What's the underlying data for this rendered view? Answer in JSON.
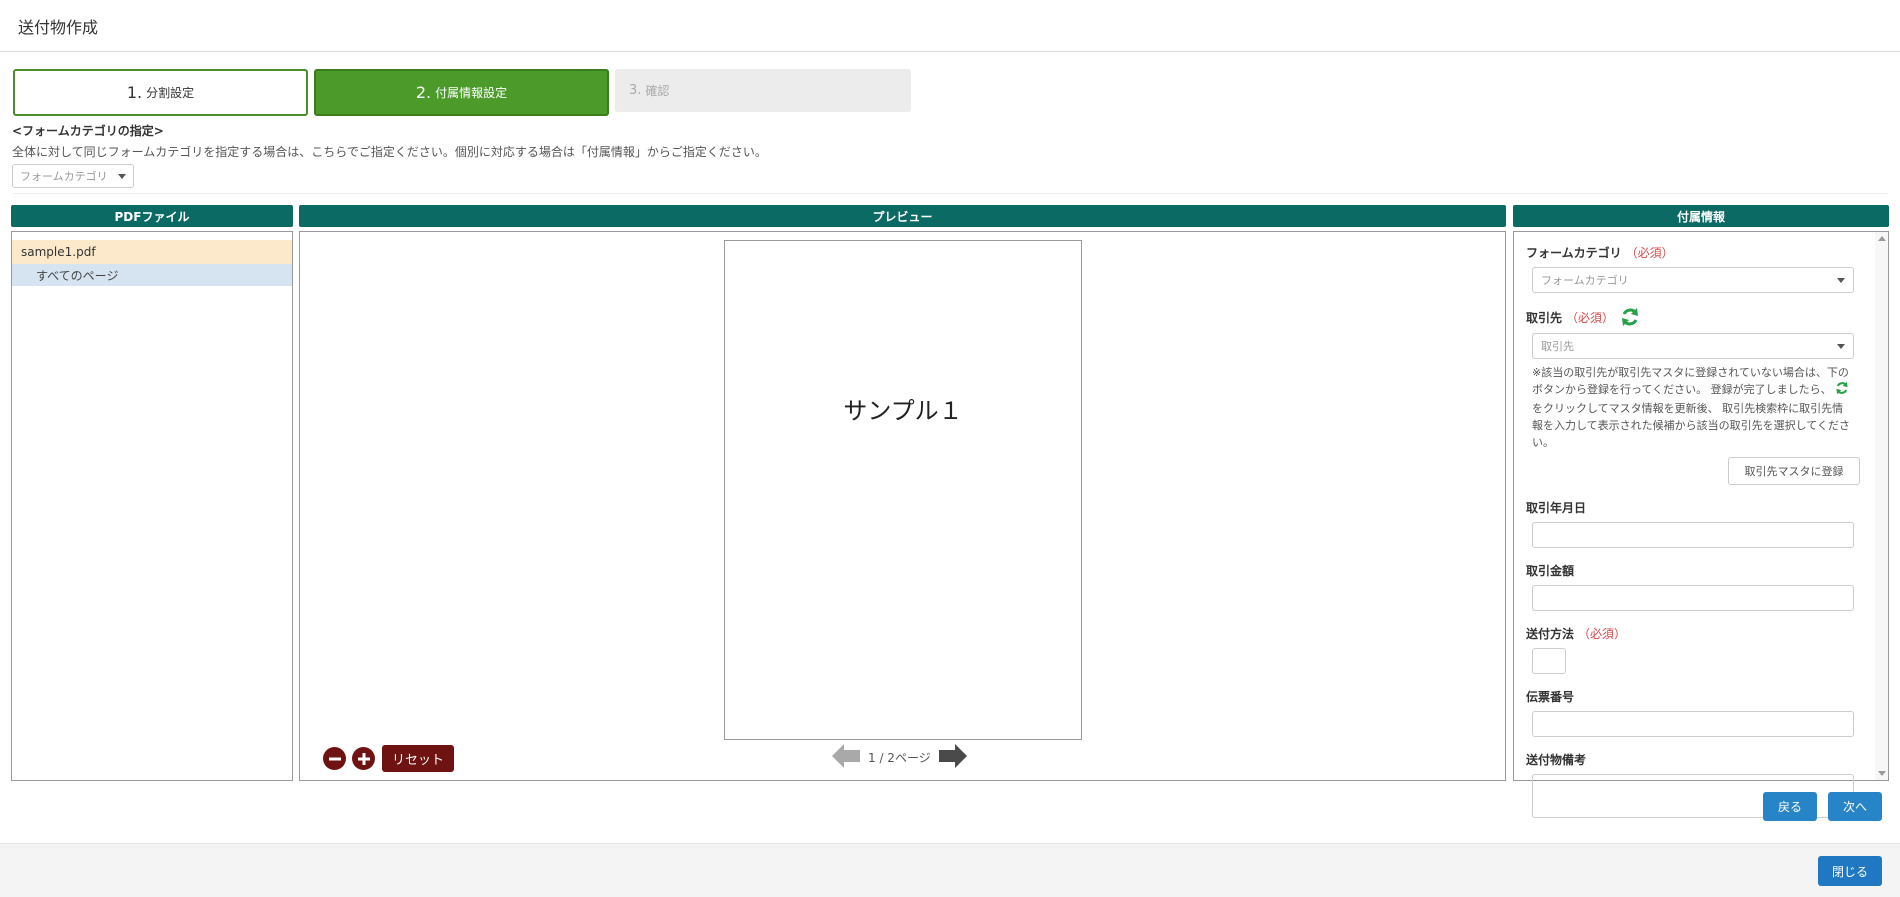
{
  "header": {
    "title": "送付物作成"
  },
  "steps": [
    {
      "num": "1.",
      "label": "分割設定"
    },
    {
      "num": "2.",
      "label": "付属情報設定"
    },
    {
      "num": "3.",
      "label": "確認"
    }
  ],
  "form_category": {
    "heading": "<フォームカテゴリの指定>",
    "description": "全体に対して同じフォームカテゴリを指定する場合は、こちらでご指定ください。個別に対応する場合は「付属情報」からご指定ください。",
    "select_placeholder": "フォームカテゴリ"
  },
  "pdf_panel": {
    "title": "PDFファイル",
    "file": "sample1.pdf",
    "pages_item": "すべてのページ"
  },
  "preview_panel": {
    "title": "プレビュー",
    "page_text": "サンプル１",
    "reset_label": "リセット",
    "page_indicator": "1 / 2ページ"
  },
  "info_panel": {
    "title": "付属情報",
    "form_category_label": "フォームカテゴリ",
    "required": "（必須）",
    "form_category_placeholder": "フォームカテゴリ",
    "partner_label": "取引先",
    "partner_placeholder": "取引先",
    "note_part1": "※該当の取引先が取引先マスタに登録されていない場合は、下のボタンから登録を行ってください。 登録が完了しましたら、",
    "note_part2": "をクリックしてマスタ情報を更新後、 取引先検索枠に取引先情報を入力して表示された候補から該当の取引先を選択してください。",
    "register_button": "取引先マスタに登録",
    "date_label": "取引年月日",
    "amount_label": "取引金額",
    "method_label": "送付方法",
    "slip_label": "伝票番号",
    "remarks_label": "送付物備考"
  },
  "nav": {
    "back": "戻る",
    "next": "次へ"
  },
  "footer": {
    "close": "閉じる"
  },
  "colors": {
    "panel_header": "#0b6a63",
    "step_active": "#4c9a2a",
    "primary_button": "#2784c6",
    "danger_button": "#6e1212",
    "refresh_icon": "#27a04a"
  }
}
